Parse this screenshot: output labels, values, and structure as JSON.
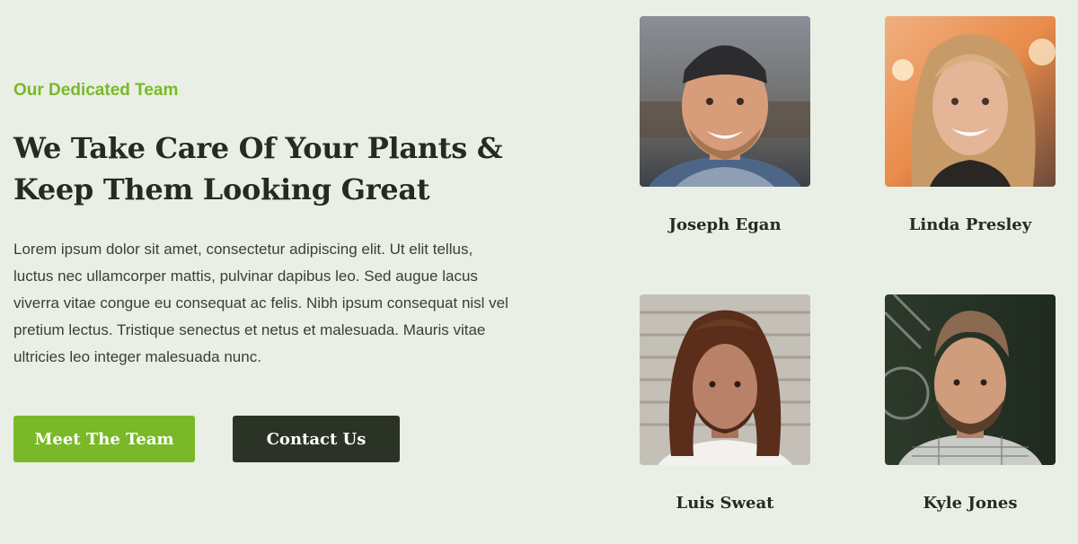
{
  "section": {
    "eyebrow": "Our Dedicated Team",
    "headline_line1": "We Take Care Of Your Plants &",
    "headline_line2": "Keep Them Looking Great",
    "body": "Lorem ipsum dolor sit amet, consectetur adipiscing elit. Ut elit tellus, luctus nec ullamcorper mattis, pulvinar dapibus leo. Sed augue lacus viverra vitae congue eu consequat ac felis. Nibh ipsum consequat nisl vel pretium lectus. Tristique senectus et netus et malesuada. Mauris vitae ultricies leo integer malesuada nunc.",
    "primary_button": "Meet The Team",
    "secondary_button": "Contact Us"
  },
  "team": [
    {
      "name": "Joseph Egan"
    },
    {
      "name": "Linda Presley"
    },
    {
      "name": "Luis Sweat"
    },
    {
      "name": "Kyle Jones"
    }
  ],
  "colors": {
    "background": "#e9efe4",
    "accent": "#79b928",
    "dark": "#2b3226",
    "text": "#262b22"
  }
}
